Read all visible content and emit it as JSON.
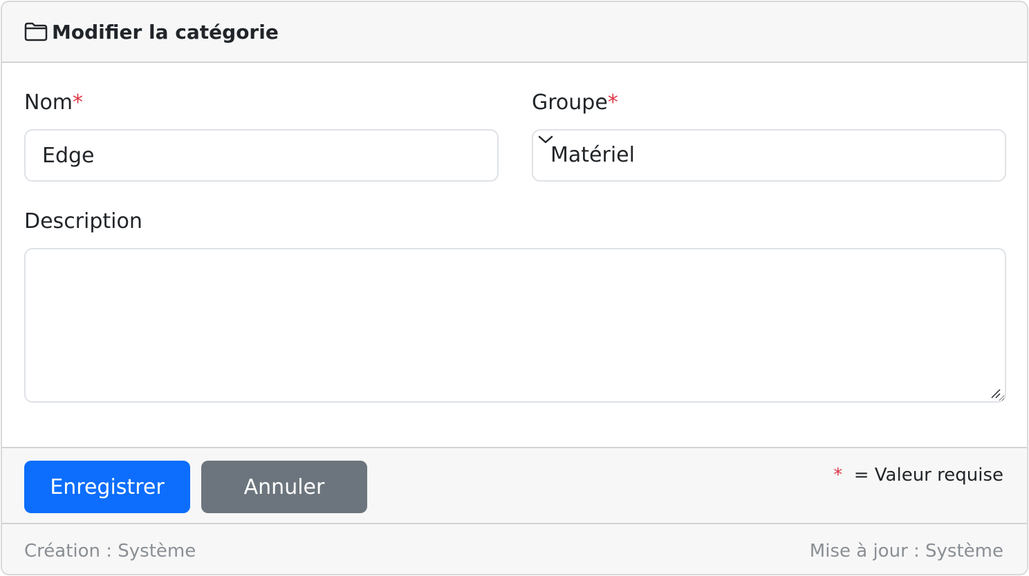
{
  "header": {
    "icon": "folder-icon",
    "title": "Modifier la catégorie"
  },
  "form": {
    "name": {
      "label": "Nom",
      "required_mark": "*",
      "value": "Edge"
    },
    "group": {
      "label": "Groupe",
      "required_mark": "*",
      "selected": "Matériel",
      "icon": "chevron-down-icon"
    },
    "description": {
      "label": "Description",
      "value": ""
    }
  },
  "actions": {
    "save_label": "Enregistrer",
    "cancel_label": "Annuler",
    "required_mark": "*",
    "required_note": "= Valeur requise"
  },
  "footer": {
    "created": "Création : Système",
    "updated": "Mise à jour : Système"
  },
  "colors": {
    "primary": "#0d6efd",
    "secondary": "#6c757d",
    "required": "#dc3545"
  }
}
